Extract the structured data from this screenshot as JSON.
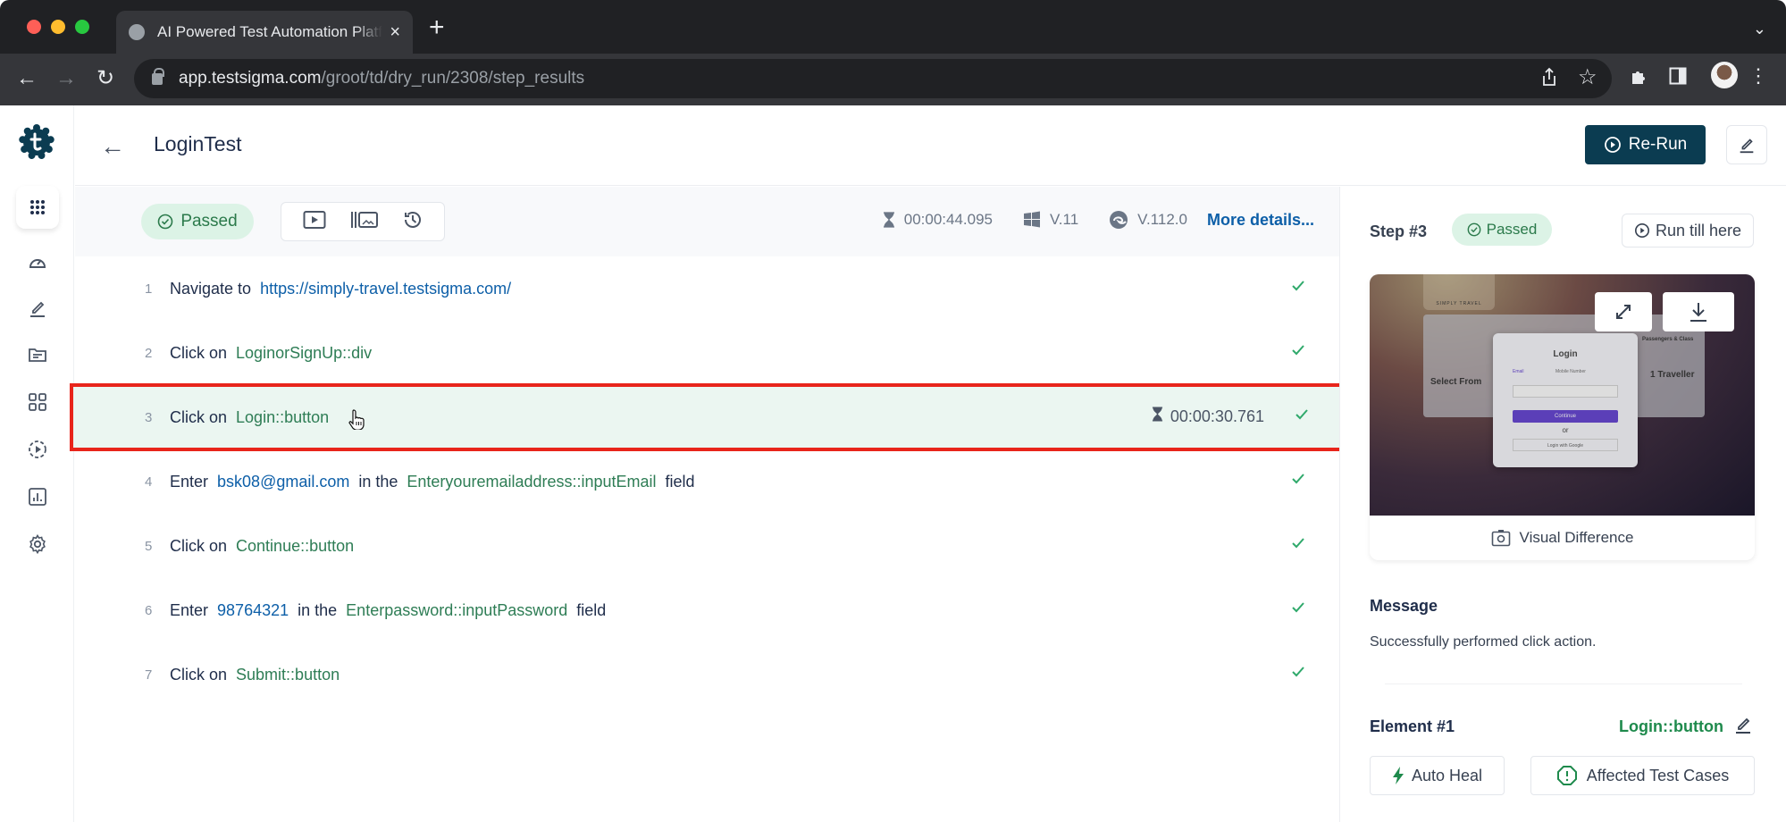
{
  "browser": {
    "tab_title": "AI Powered Test Automation Platform",
    "url_host": "app.testsigma.com",
    "url_path": "/groot/td/dry_run/2308/step_results",
    "traffic_colors": [
      "#ff5f57",
      "#febc2e",
      "#28c840"
    ]
  },
  "sidebar": {
    "items": [
      {
        "name": "dashboard-icon"
      },
      {
        "name": "test-development-icon"
      },
      {
        "name": "test-data-icon"
      },
      {
        "name": "elements-icon"
      },
      {
        "name": "run-icon"
      },
      {
        "name": "reports-icon"
      },
      {
        "name": "settings-icon"
      }
    ]
  },
  "header": {
    "title": "LoginTest",
    "rerun_label": "Re-Run"
  },
  "runbar": {
    "status": "Passed",
    "duration": "00:00:44.095",
    "os_version": "V.11",
    "browser_version": "V.112.0",
    "more_details": "More details..."
  },
  "steps": [
    {
      "num": "1",
      "parts": [
        {
          "type": "t",
          "text": "Navigate to"
        },
        {
          "type": "link",
          "text": "https://simply-travel.testsigma.com/"
        }
      ],
      "status": "passed"
    },
    {
      "num": "2",
      "parts": [
        {
          "type": "t",
          "text": "Click on"
        },
        {
          "type": "el",
          "text": "LoginorSignUp::div"
        }
      ],
      "status": "passed"
    },
    {
      "num": "3",
      "parts": [
        {
          "type": "t",
          "text": "Click on"
        },
        {
          "type": "el",
          "text": "Login::button"
        }
      ],
      "status": "passed",
      "duration": "00:00:30.761",
      "selected": true
    },
    {
      "num": "4",
      "parts": [
        {
          "type": "t",
          "text": "Enter"
        },
        {
          "type": "link",
          "text": "bsk08@gmail.com"
        },
        {
          "type": "t",
          "text": "in the"
        },
        {
          "type": "el",
          "text": "Enteryouremailaddress::inputEmail"
        },
        {
          "type": "t",
          "text": "field"
        }
      ],
      "status": "passed"
    },
    {
      "num": "5",
      "parts": [
        {
          "type": "t",
          "text": "Click on"
        },
        {
          "type": "el",
          "text": "Continue::button"
        }
      ],
      "status": "passed"
    },
    {
      "num": "6",
      "parts": [
        {
          "type": "t",
          "text": "Enter"
        },
        {
          "type": "link",
          "text": "98764321"
        },
        {
          "type": "t",
          "text": "in the"
        },
        {
          "type": "el",
          "text": "Enterpassword::inputPassword"
        },
        {
          "type": "t",
          "text": "field"
        }
      ],
      "status": "passed"
    },
    {
      "num": "7",
      "parts": [
        {
          "type": "t",
          "text": "Click on"
        },
        {
          "type": "el",
          "text": "Submit::button"
        }
      ],
      "status": "passed"
    }
  ],
  "panel": {
    "step_label": "Step #3",
    "status": "Passed",
    "run_till_here": "Run till here",
    "screenshot": {
      "brand": "SIMPLY TRAVEL",
      "modal_title": "Login",
      "radio_email": "Email",
      "radio_mobile": "Mobile Number",
      "continue": "Continue",
      "or": "or",
      "google": "Login with Google",
      "select_from": "Select From",
      "passengers": "Passengers & Class",
      "traveller": "1 Traveller"
    },
    "visual_difference": "Visual Difference",
    "message_label": "Message",
    "message_text": "Successfully performed click action.",
    "element_label": "Element #1",
    "element_name": "Login::button",
    "auto_heal": "Auto Heal",
    "affected": "Affected Test Cases"
  },
  "colors": {
    "brand": "#0b3c51",
    "passed_bg": "#dcf3e6",
    "passed_text": "#2b7a4b",
    "link": "#0d5fa8",
    "element": "#2e7d55",
    "highlight": "#e8251b"
  }
}
